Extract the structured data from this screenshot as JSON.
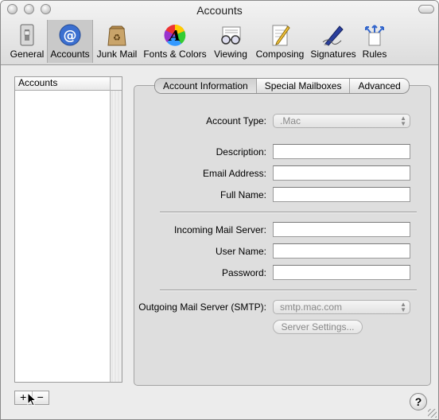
{
  "window": {
    "title": "Accounts"
  },
  "toolbar": {
    "items": [
      {
        "label": "General",
        "icon": "switch-icon"
      },
      {
        "label": "Accounts",
        "icon": "at-sign-icon",
        "active": true
      },
      {
        "label": "Junk Mail",
        "icon": "recycle-bag-icon"
      },
      {
        "label": "Fonts & Colors",
        "icon": "font-color-wheel-icon"
      },
      {
        "label": "Viewing",
        "icon": "glasses-icon"
      },
      {
        "label": "Composing",
        "icon": "pencil-paper-icon"
      },
      {
        "label": "Signatures",
        "icon": "fountain-pen-icon"
      },
      {
        "label": "Rules",
        "icon": "rules-arrows-icon"
      }
    ]
  },
  "accounts_list": {
    "header": "Accounts",
    "add_label": "+",
    "remove_label": "−"
  },
  "tabs": [
    {
      "label": "Account Information",
      "active": true
    },
    {
      "label": "Special Mailboxes"
    },
    {
      "label": "Advanced"
    }
  ],
  "form": {
    "account_type": {
      "label": "Account Type:",
      "value": ".Mac"
    },
    "description": {
      "label": "Description:",
      "value": ""
    },
    "email": {
      "label": "Email Address:",
      "value": ""
    },
    "full_name": {
      "label": "Full Name:",
      "value": ""
    },
    "incoming_server": {
      "label": "Incoming Mail Server:",
      "value": ""
    },
    "user_name": {
      "label": "User Name:",
      "value": ""
    },
    "password": {
      "label": "Password:",
      "value": ""
    },
    "smtp": {
      "label": "Outgoing Mail Server (SMTP):",
      "value": "smtp.mac.com"
    },
    "server_settings_label": "Server Settings..."
  },
  "help_label": "?"
}
